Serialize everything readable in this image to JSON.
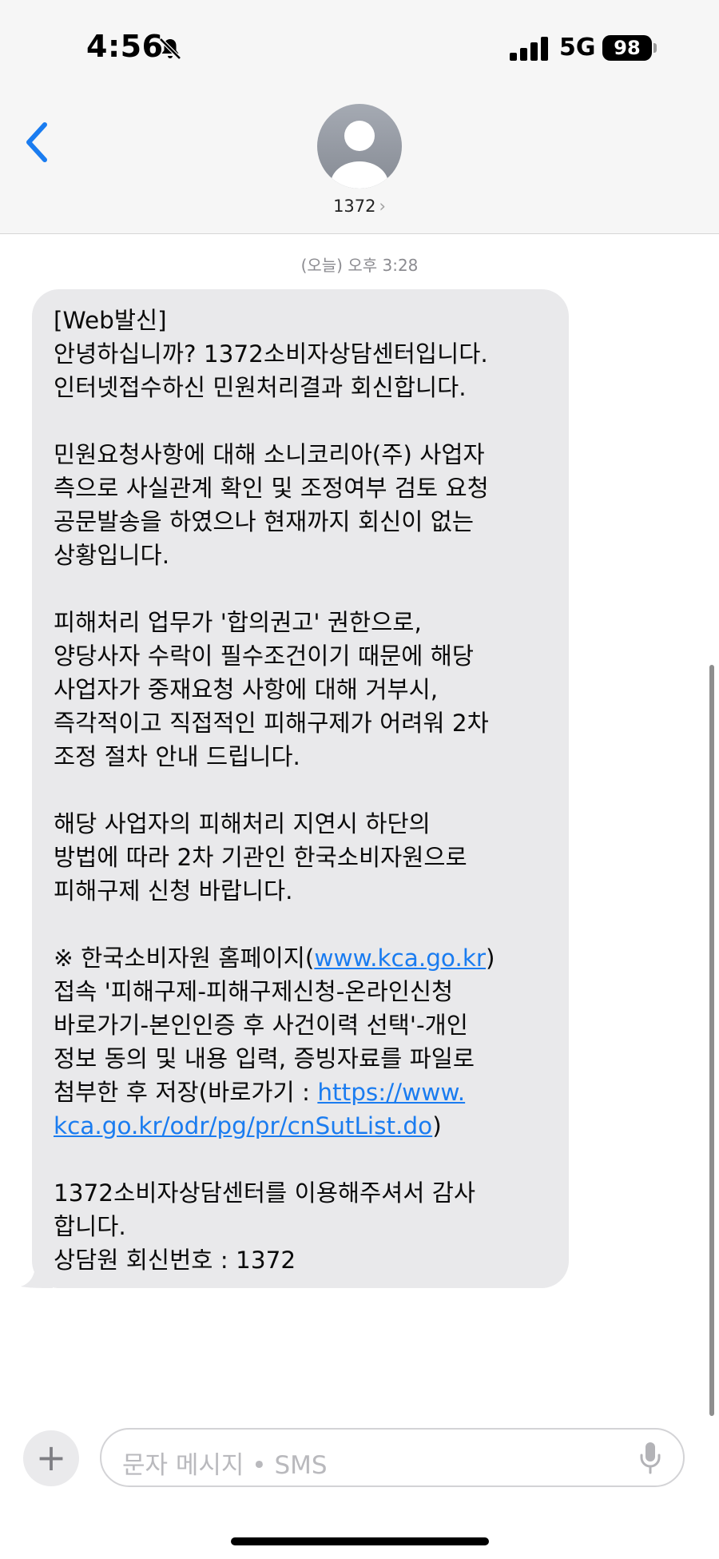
{
  "status_bar": {
    "time": "4:56",
    "network": "5G",
    "battery": "98"
  },
  "nav": {
    "contact_name": "1372",
    "contact_chevron": "›"
  },
  "conversation": {
    "timestamp": "(오늘) 오후 3:28",
    "message_lines": [
      "[Web발신]",
      "안녕하십니까? 1372소비자상담센터입니다.",
      "인터넷접수하신 민원처리결과 회신합니다.",
      "",
      "민원요청사항에 대해 소니코리아(주) 사업자",
      "측으로 사실관계 확인 및 조정여부 검토 요청",
      "공문발송을 하였으나 현재까지 회신이 없는",
      "상황입니다.",
      "",
      "피해처리 업무가 '합의권고' 권한으로,",
      "양당사자 수락이 필수조건이기 때문에 해당",
      "사업자가 중재요청 사항에 대해 거부시,",
      "즉각적이고 직접적인 피해구제가 어려워 2차",
      "조정 절차 안내 드립니다.",
      "",
      "해당 사업자의 피해처리 지연시 하단의",
      "방법에 따라 2차 기관인 한국소비자원으로",
      "피해구제 신청 바랍니다.",
      ""
    ],
    "link_line1": {
      "prefix": "※ 한국소비자원 홈페이지(",
      "link": "www.kca.go.kr",
      "suffix": ")"
    },
    "middle_lines": [
      "접속 '피해구제-피해구제신청-온라인신청",
      "바로가기-본인인증 후 사건이력 선택'-개인",
      "정보 동의 및 내용 입력, 증빙자료를 파일로"
    ],
    "link_line2": {
      "prefix": "첨부한 후 저장(바로가기 : ",
      "link": "https://www."
    },
    "link_line3": {
      "link": "kca.go.kr/odr/pg/pr/cnSutList.do",
      "suffix": ")"
    },
    "closing_lines": [
      "",
      "1372소비자상담센터를 이용해주셔서 감사",
      "합니다.",
      "상담원 회신번호 : 1372"
    ],
    "bubble_color": "#e9e9eb",
    "link_color": "#1a7cf0"
  },
  "input_bar": {
    "placeholder": "문자 메시지 • SMS",
    "add_label": "+"
  },
  "icons": {
    "back": "chevron-left-icon",
    "silent": "bell-slash-icon",
    "signal": "cellular-signal-icon",
    "avatar": "person-icon",
    "mic": "microphone-icon"
  },
  "colors": {
    "accent": "#1a7cf0",
    "header_bg": "#f6f6f6"
  }
}
